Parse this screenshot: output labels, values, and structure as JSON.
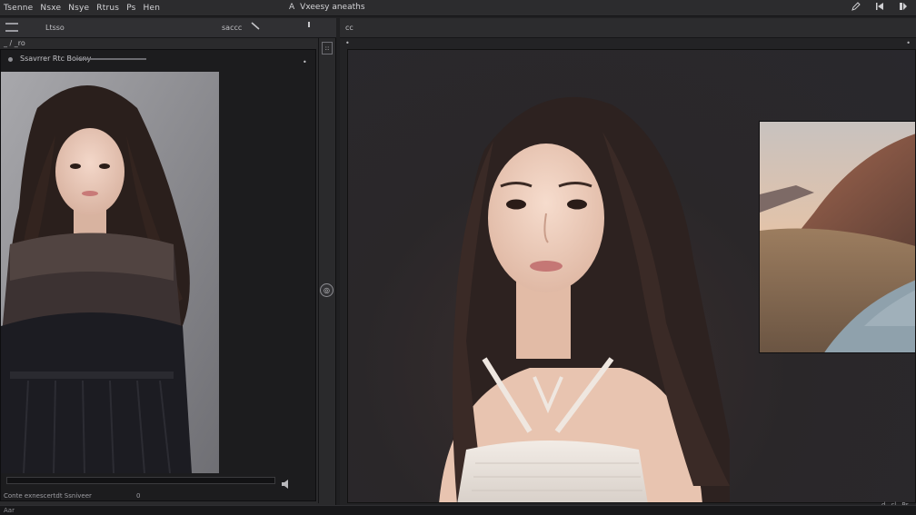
{
  "menubar": {
    "items": [
      "Tsenne",
      "Nsxe",
      "Nsye",
      "Rtrus",
      "Ps",
      "Hen"
    ],
    "doc_prefix": "A",
    "doc_title": "Vxeesy aneaths",
    "icons": [
      "pen-icon",
      "skip-icon",
      "close-icon"
    ]
  },
  "left_panel": {
    "toolbar_tab": "Ltsso",
    "toolbar_mid": "saccc",
    "head_label": "_ / _ro",
    "viewer_title": "Ssavrrer  Rtc  Boicny",
    "footer_text": "Conte exnescertdt  Ssniveer",
    "footer_page": "0"
  },
  "right_panel": {
    "toolbar_label": "cc",
    "status": [
      "d",
      "cl",
      "Ps"
    ]
  },
  "bottom_strip": "Aar",
  "colors": {
    "menubar_bg": "#2c2c2e",
    "panel_bg": "#2a2a2c",
    "canvas_bg": "#29282d"
  }
}
